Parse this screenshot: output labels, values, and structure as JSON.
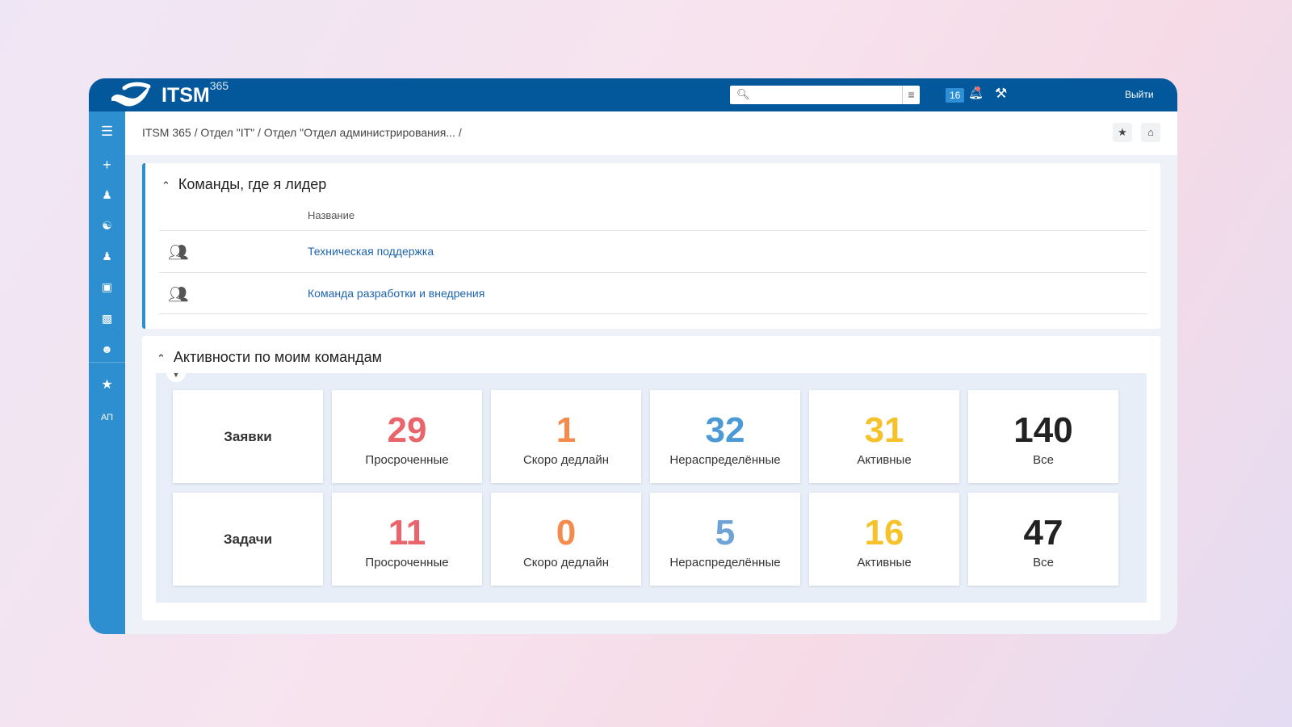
{
  "header": {
    "logo": "ITSM",
    "logo_sup": "365",
    "search_placeholder": "",
    "notif_count": "16",
    "logout": "Выйти"
  },
  "sidebar": {
    "items": [
      "menu",
      "create",
      "assign-user",
      "handshake",
      "transfer-user",
      "knowledge",
      "reports",
      "profile",
      "favorites"
    ],
    "initials": "АП"
  },
  "breadcrumb": "ITSM 365 / Отдел \"IT\" / Отдел \"Отдел администрирования... /",
  "teams": {
    "title": "Команды, где я лидер",
    "column": "Название",
    "rows": [
      "Техническая поддержка",
      "Команда разработки и внедрения"
    ]
  },
  "activity": {
    "title": "Активности по моим командам",
    "rows": [
      {
        "label": "Заявки",
        "cells": [
          {
            "value": "29",
            "label": "Просроченные"
          },
          {
            "value": "1",
            "label": "Скоро дедлайн"
          },
          {
            "value": "32",
            "label": "Нераспределённые"
          },
          {
            "value": "31",
            "label": "Активные"
          },
          {
            "value": "140",
            "label": "Все"
          }
        ]
      },
      {
        "label": "Задачи",
        "cells": [
          {
            "value": "11",
            "label": "Просроченные"
          },
          {
            "value": "0",
            "label": "Скоро дедлайн"
          },
          {
            "value": "5",
            "label": "Нераспределённые"
          },
          {
            "value": "16",
            "label": "Активные"
          },
          {
            "value": "47",
            "label": "Все"
          }
        ]
      }
    ]
  },
  "colors": {
    "header": "#03589c",
    "sidebar": "#2d8fcf",
    "overdue": "#e9646b",
    "deadline": "#f48a4c",
    "unassigned": "#4b9ad6",
    "active": "#f6c22b",
    "all": "#222222"
  }
}
